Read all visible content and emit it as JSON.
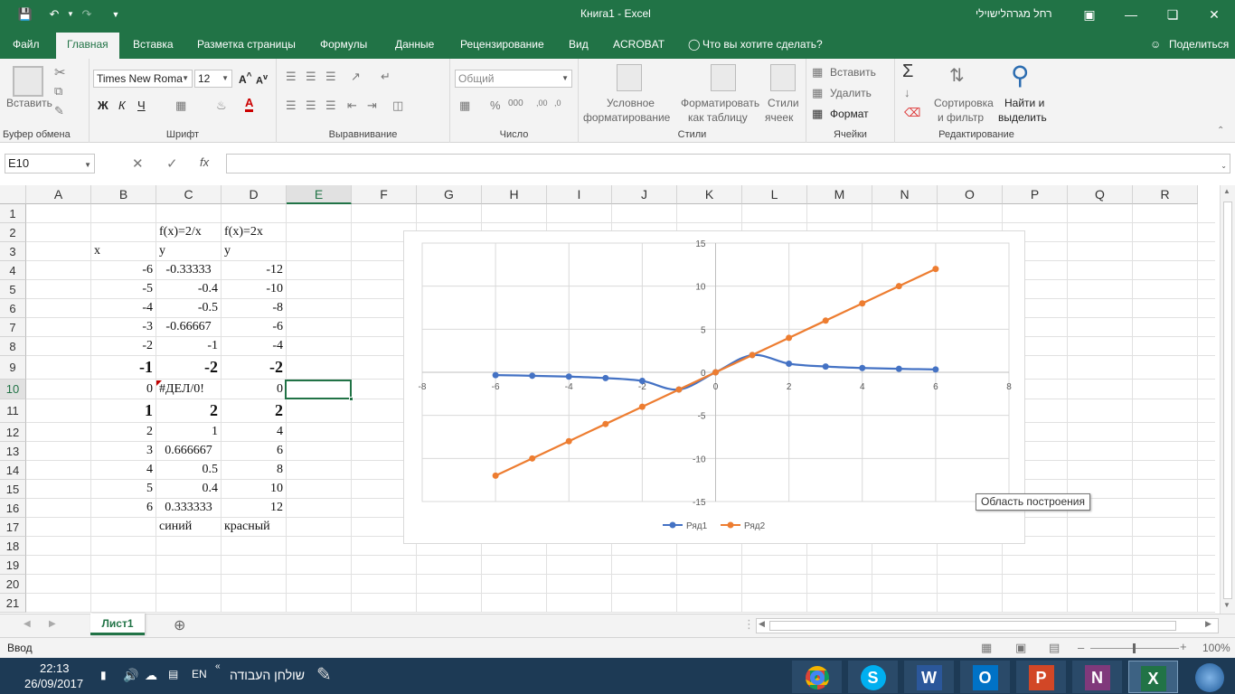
{
  "window": {
    "title": "Книга1  -  Excel",
    "user": "רחל מגרהלישוילי"
  },
  "tabs": [
    "Файл",
    "Главная",
    "Вставка",
    "Разметка страницы",
    "Формулы",
    "Данные",
    "Рецензирование",
    "Вид",
    "ACROBAT",
    "Что вы хотите сделать?"
  ],
  "share": "Поделиться",
  "ribbon": {
    "paste": "Вставить",
    "clipboard": "Буфер обмена",
    "font_name": "Times New Roma",
    "font_size": "12",
    "bold": "Ж",
    "italic": "К",
    "underline": "Ч",
    "font_group": "Шрифт",
    "align_group": "Выравнивание",
    "number_format": "Общий",
    "number_group": "Число",
    "cond_format1": "Условное",
    "cond_format2": "форматирование",
    "table_format1": "Форматировать",
    "table_format2": "как таблицу",
    "cell_styles1": "Стили",
    "cell_styles2": "ячеек",
    "styles_group": "Стили",
    "insert": "Вставить",
    "delete": "Удалить",
    "format": "Формат",
    "cells_group": "Ячейки",
    "sort1": "Сортировка",
    "sort2": "и фильтр",
    "find1": "Найти и",
    "find2": "выделить",
    "edit_group": "Редактирование"
  },
  "formula_bar": {
    "name_box": "E10",
    "fx": "fx",
    "formula": ""
  },
  "columns": [
    "A",
    "B",
    "C",
    "D",
    "E",
    "F",
    "G",
    "H",
    "I",
    "J",
    "K",
    "L",
    "M",
    "N",
    "O",
    "P",
    "Q",
    "R"
  ],
  "rows": [
    "1",
    "2",
    "3",
    "4",
    "5",
    "6",
    "7",
    "8",
    "9",
    "10",
    "11",
    "12",
    "13",
    "14",
    "15",
    "16",
    "17",
    "18",
    "19",
    "20",
    "21"
  ],
  "cells": {
    "C2": "f(x)=2/x",
    "D2": "f(x)=2x",
    "B3": "x",
    "C3": "y",
    "D3": "y",
    "B4": "-6",
    "C4": "-0.33333",
    "D4": "-12",
    "B5": "-5",
    "C5": "-0.4",
    "D5": "-10",
    "B6": "-4",
    "C6": "-0.5",
    "D6": "-8",
    "B7": "-3",
    "C7": "-0.66667",
    "D7": "-6",
    "B8": "-2",
    "C8": "-1",
    "D8": "-4",
    "B9": "-1",
    "C9": "-2",
    "D9": "-2",
    "B10": "0",
    "C10": "#ДЕЛ/0!",
    "D10": "0",
    "B11": "1",
    "C11": "2",
    "D11": "2",
    "B12": "2",
    "C12": "1",
    "D12": "4",
    "B13": "3",
    "C13": "0.666667",
    "D13": "6",
    "B14": "4",
    "C14": "0.5",
    "D14": "8",
    "B15": "5",
    "C15": "0.4",
    "D15": "10",
    "B16": "6",
    "C16": "0.333333",
    "D16": "12",
    "C17": "синий",
    "D17": "красный"
  },
  "chart_data": {
    "type": "scatter",
    "title": "",
    "xlim": [
      -8,
      8
    ],
    "ylim": [
      -15,
      15
    ],
    "x_ticks": [
      "-8",
      "-6",
      "-4",
      "-2",
      "0",
      "2",
      "4",
      "6",
      "8"
    ],
    "y_ticks": [
      "15",
      "10",
      "5",
      "0",
      "-5",
      "-10",
      "-15"
    ],
    "grid": true,
    "smooth": true,
    "legend": "bottom",
    "series": [
      {
        "name": "Ряд1",
        "color": "#4472c4",
        "x": [
          -6,
          -5,
          -4,
          -3,
          -2,
          -1,
          0,
          1,
          2,
          3,
          4,
          5,
          6
        ],
        "y": [
          -0.33333,
          -0.4,
          -0.5,
          -0.66667,
          -1,
          -2,
          0,
          2,
          1,
          0.666667,
          0.5,
          0.4,
          0.333333
        ]
      },
      {
        "name": "Ряд2",
        "color": "#ed7d31",
        "x": [
          -6,
          -5,
          -4,
          -3,
          -2,
          -1,
          0,
          1,
          2,
          3,
          4,
          5,
          6
        ],
        "y": [
          -12,
          -10,
          -8,
          -6,
          -4,
          -2,
          0,
          2,
          4,
          6,
          8,
          10,
          12
        ]
      }
    ]
  },
  "tooltip": "Область построения",
  "sheet_tab": "Лист1",
  "status": {
    "mode": "Ввод",
    "zoom": "100%"
  },
  "taskbar": {
    "time": "22:13",
    "date": "26/09/2017",
    "lang": "EN",
    "desk": "שולחן העבודה"
  }
}
